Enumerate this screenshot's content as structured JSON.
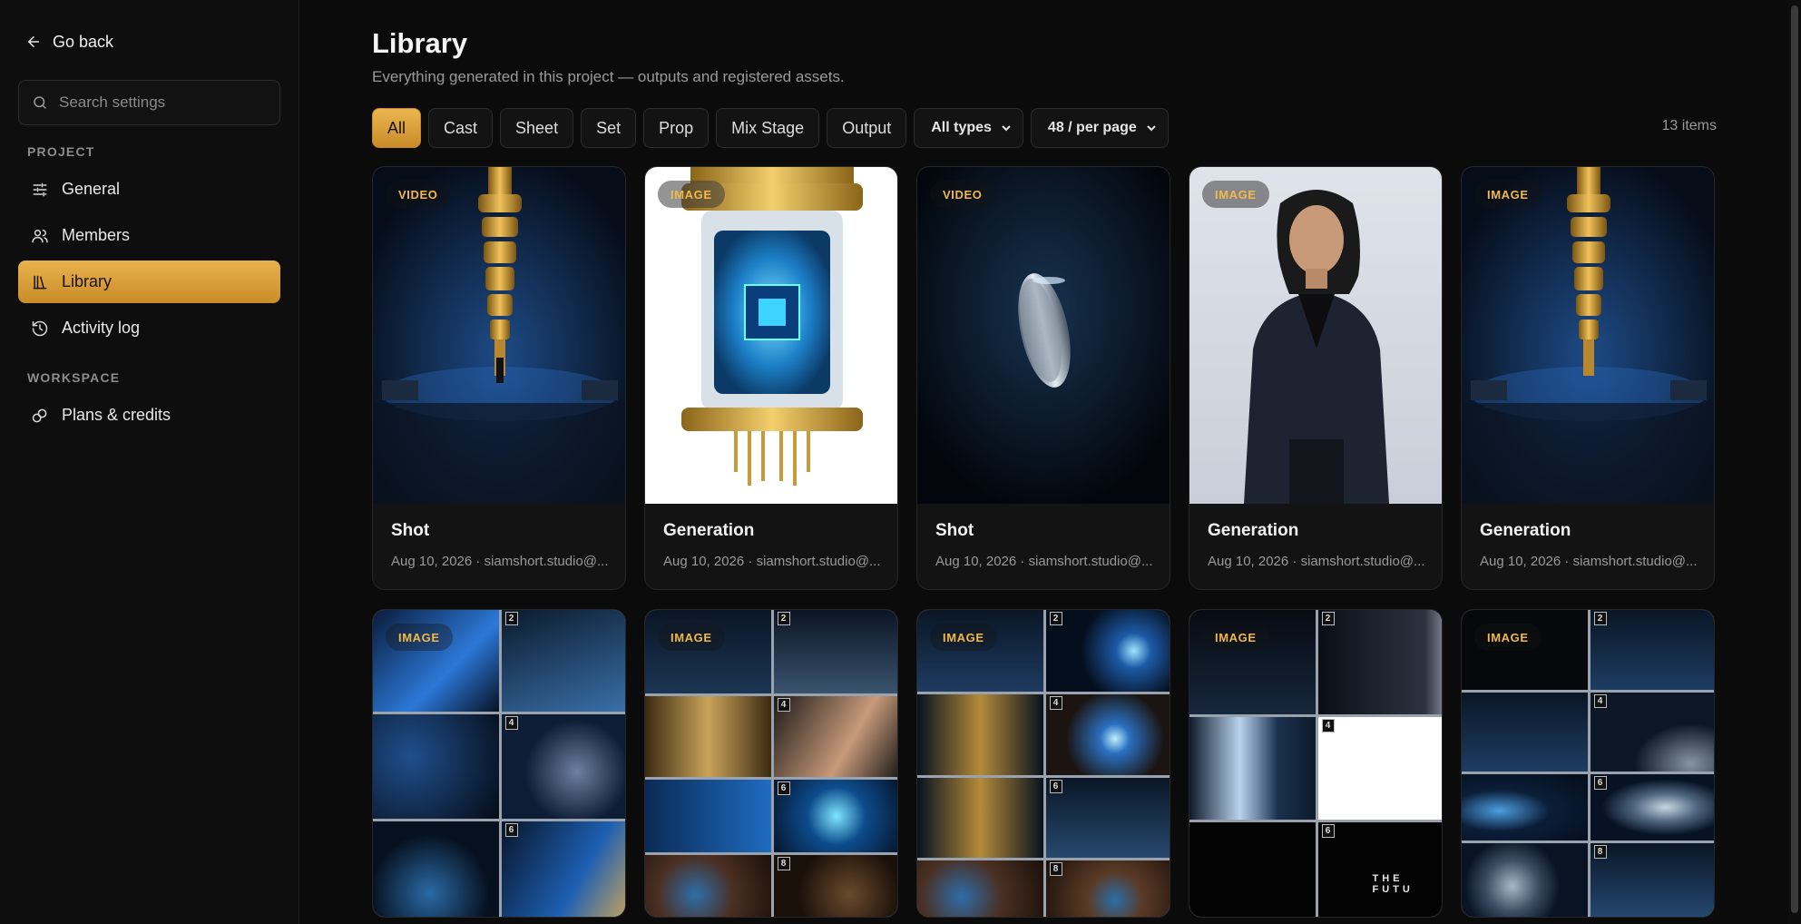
{
  "sidebar": {
    "go_back": "Go back",
    "search_placeholder": "Search settings",
    "section_project": "PROJECT",
    "section_workspace": "WORKSPACE",
    "items": [
      {
        "label": "General",
        "icon": "sliders-icon"
      },
      {
        "label": "Members",
        "icon": "users-icon"
      },
      {
        "label": "Library",
        "icon": "library-icon",
        "active": true
      },
      {
        "label": "Activity log",
        "icon": "history-icon"
      },
      {
        "label": "Plans & credits",
        "icon": "coins-icon"
      }
    ]
  },
  "main": {
    "title": "Library",
    "subtitle": "Everything generated in this project — outputs and registered assets.",
    "filters": [
      "All",
      "Cast",
      "Sheet",
      "Set",
      "Prop",
      "Mix Stage",
      "Output"
    ],
    "active_filter": "All",
    "type_select": "All types",
    "per_page_select": "48 / per page",
    "item_count": "13 items"
  },
  "cards": [
    {
      "badge": "VIDEO",
      "title": "Shot",
      "meta": "Aug 10, 2026 · siamshort.studio@..."
    },
    {
      "badge": "IMAGE",
      "title": "Generation",
      "meta": "Aug 10, 2026 · siamshort.studio@..."
    },
    {
      "badge": "VIDEO",
      "title": "Shot",
      "meta": "Aug 10, 2026 · siamshort.studio@..."
    },
    {
      "badge": "IMAGE",
      "title": "Generation",
      "meta": "Aug 10, 2026 · siamshort.studio@..."
    },
    {
      "badge": "IMAGE",
      "title": "Generation",
      "meta": "Aug 10, 2026 · siamshort.studio@..."
    },
    {
      "badge": "IMAGE"
    },
    {
      "badge": "IMAGE"
    },
    {
      "badge": "IMAGE"
    },
    {
      "badge": "IMAGE"
    },
    {
      "badge": "IMAGE"
    }
  ],
  "mosaic_text": "THE FUTU",
  "colors": {
    "accent": "#e0a83f",
    "background": "#0b0b0b",
    "badge_text": "#f2b84a"
  }
}
